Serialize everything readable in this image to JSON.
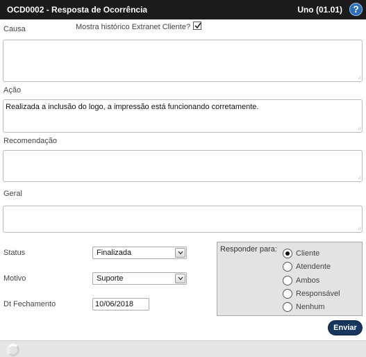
{
  "header": {
    "title": "OCD0002 - Resposta de Ocorrência",
    "company": "Uno (01.01)",
    "help_label": "?"
  },
  "form": {
    "causa_label": "Causa",
    "historico_label": "Mostra histórico Extranet Cliente?",
    "historico_checked": true,
    "causa_value": "",
    "acao_label": "Ação",
    "acao_value": "Realizada a inclusão do logo, a impressão está funcionando corretamente.",
    "recomendacao_label": "Recomendação",
    "recomendacao_value": "",
    "geral_label": "Geral",
    "geral_value": "",
    "status_label": "Status",
    "status_value": "Finalizada",
    "motivo_label": "Motivo",
    "motivo_value": "Suporte",
    "fechamento_label": "Dt Fechamento",
    "fechamento_value": "10/06/2018"
  },
  "responder": {
    "label": "Responder para:",
    "options": [
      "Cliente",
      "Atendente",
      "Ambos",
      "Responsável",
      "Nenhum"
    ],
    "selected": "Cliente"
  },
  "actions": {
    "send_label": "Enviar"
  },
  "colors": {
    "titlebar": "#1b1b1b",
    "button": "#17365d",
    "help": "#2f6fb8"
  }
}
